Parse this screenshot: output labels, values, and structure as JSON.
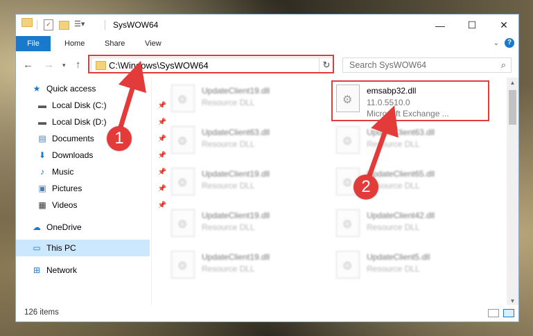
{
  "window": {
    "title": "SysWOW64",
    "controls": {
      "minimize": "—",
      "maximize": "☐",
      "close": "✕"
    }
  },
  "ribbon": {
    "tabs": [
      "File",
      "Home",
      "Share",
      "View"
    ],
    "help": "?"
  },
  "address": {
    "path": "C:\\Windows\\SysWOW64",
    "refresh": "↻"
  },
  "search": {
    "placeholder": "Search SysWOW64"
  },
  "nav": {
    "quick_access": "Quick access",
    "items": [
      "Local Disk (C:)",
      "Local Disk (D:)",
      "Documents",
      "Downloads",
      "Music",
      "Pictures",
      "Videos"
    ],
    "onedrive": "OneDrive",
    "thispc": "This PC",
    "network": "Network"
  },
  "files": {
    "highlighted": {
      "name": "emsabp32.dll",
      "version": "11.0.5510.0",
      "desc": "Microsoft Exchange ..."
    },
    "left_col": [
      {
        "name": "UpdateClient19.dll",
        "desc": "Resource DLL"
      },
      {
        "name": "UpdateClient63.dll",
        "desc": "Resource DLL"
      },
      {
        "name": "UpdateClient19.dll",
        "desc": "Resource DLL"
      },
      {
        "name": "UpdateClient19.dll",
        "desc": "Resource DLL"
      },
      {
        "name": "UpdateClient19.dll",
        "desc": "Resource DLL"
      }
    ],
    "right_col": [
      {
        "name": "UpdateClient63.dll",
        "desc": "Resource DLL"
      },
      {
        "name": "UpdateClient65.dll",
        "desc": "Resource DLL"
      },
      {
        "name": "UpdateClient42.dll",
        "desc": "Resource DLL"
      },
      {
        "name": "UpdateClient5.dll",
        "desc": "Resource DLL"
      }
    ]
  },
  "status": {
    "count": "126 items"
  },
  "annotations": {
    "step1": "1",
    "step2": "2",
    "highlight_color": "#e33a3a"
  }
}
